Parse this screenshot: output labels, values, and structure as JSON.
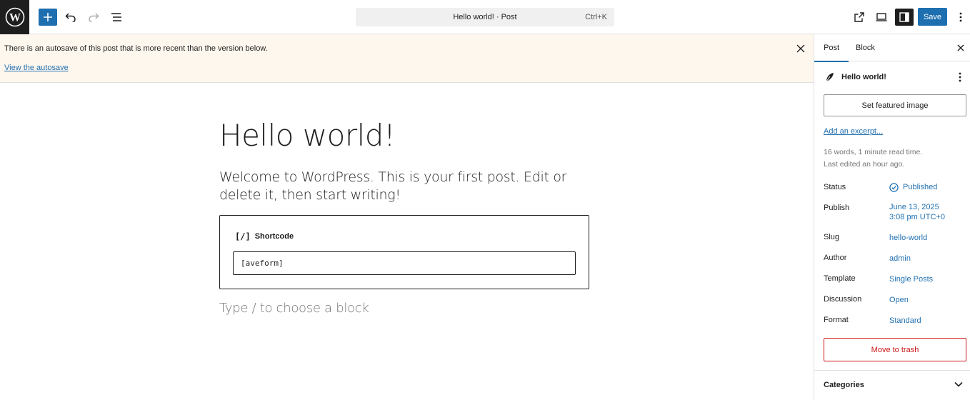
{
  "toolbar": {
    "command_title": "Hello world! · Post",
    "command_shortcut": "Ctrl+K",
    "save_label": "Save"
  },
  "notice": {
    "message": "There is an autosave of this post that is more recent than the version below.",
    "link_label": "View the autosave"
  },
  "editor": {
    "title": "Hello world!",
    "paragraph": "Welcome to WordPress. This is your first post. Edit or delete it, then start writing!",
    "shortcode": {
      "label": "Shortcode",
      "icon_text": "[/]",
      "value": "[aveform]"
    },
    "appender_placeholder": "Type / to choose a block"
  },
  "sidebar": {
    "tabs": [
      "Post",
      "Block"
    ],
    "post_title": "Hello world!",
    "featured_image_label": "Set featured image",
    "excerpt_link": "Add an excerpt...",
    "word_count": "16 words, 1 minute read time.",
    "last_edited": "Last edited an hour ago.",
    "rows": {
      "status": {
        "label": "Status",
        "value": "Published"
      },
      "publish": {
        "label": "Publish",
        "value_line1": "June 13, 2025",
        "value_line2": "3:08 pm UTC+0"
      },
      "slug": {
        "label": "Slug",
        "value": "hello-world"
      },
      "author": {
        "label": "Author",
        "value": "admin"
      },
      "template": {
        "label": "Template",
        "value": "Single Posts"
      },
      "discussion": {
        "label": "Discussion",
        "value": "Open"
      },
      "format": {
        "label": "Format",
        "value": "Standard"
      }
    },
    "trash_label": "Move to trash",
    "categories_label": "Categories"
  },
  "colors": {
    "accent": "#1d6fb0",
    "link": "#2271b1",
    "danger": "#cc1818",
    "notice_bg": "#fef7ee"
  }
}
